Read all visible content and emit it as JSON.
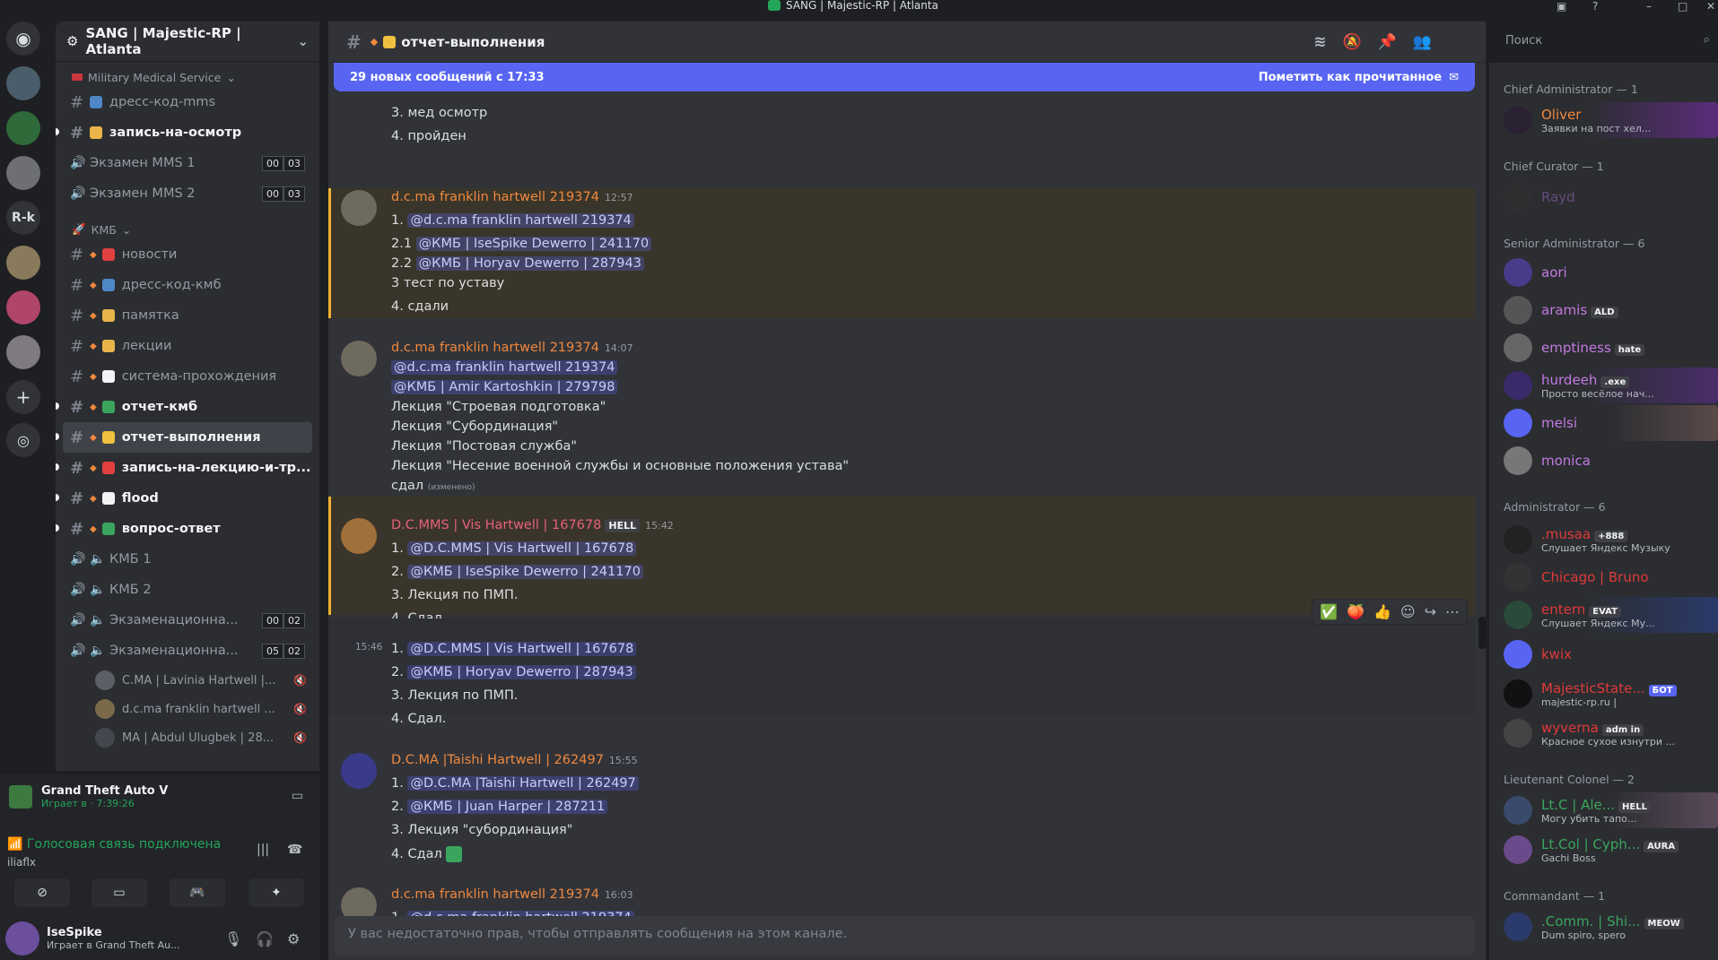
{
  "window": {
    "title": "SANG | Majestic-RP | Atlanta"
  },
  "rail": {
    "rk_label": "R-k"
  },
  "server": {
    "name": "SANG | Majestic-RP | Atlanta"
  },
  "sidebar": {
    "cat1": "Military Medical Service",
    "cat1_channels": [
      {
        "name": "дресс-код-mms",
        "type": "text"
      },
      {
        "name": "запись-на-осмотр",
        "type": "text",
        "unread": true
      },
      {
        "name": "Экзамен MMS 1",
        "type": "voice",
        "c1": "00",
        "c2": "03"
      },
      {
        "name": "Экзамен MMS 2",
        "type": "voice",
        "c1": "00",
        "c2": "03"
      }
    ],
    "cat2": "КМБ",
    "cat2_channels": [
      {
        "name": "новости"
      },
      {
        "name": "дресс-код-кмб"
      },
      {
        "name": "памятка"
      },
      {
        "name": "лекции"
      },
      {
        "name": "система-прохождения"
      },
      {
        "name": "отчет-кмб",
        "unread": true
      },
      {
        "name": "отчет-выполнения",
        "active": true
      },
      {
        "name": "запись-на-лекцию-и-тр...",
        "unread": true
      },
      {
        "name": "flood",
        "unread": true
      },
      {
        "name": "вопрос-ответ",
        "unread": true
      }
    ],
    "voice_channels": [
      {
        "name": "КМБ 1"
      },
      {
        "name": "КМБ 2"
      },
      {
        "name": "Экзаменационна...",
        "c1": "00",
        "c2": "02"
      },
      {
        "name": "Экзаменационна...",
        "c1": "05",
        "c2": "02"
      }
    ],
    "voice_users": [
      "C.MA | Lavinia Hartwell |...",
      "d.c.ma franklin hartwell ...",
      "MA | Abdul Ulugbek | 28..."
    ]
  },
  "panel": {
    "game_title": "Grand Theft Auto V",
    "game_time": "Играет в · 7:39:26",
    "voice_status": "Голосовая связь подключена",
    "voice_user": "iliaflx",
    "user_name": "IseSpike",
    "user_status": "Играет в Grand Theft Au..."
  },
  "chat": {
    "channel": "отчет-выполнения",
    "new_messages": "29 новых сообщений с 17:33",
    "mark_read": "Пометить как прочитанное",
    "search_placeholder": "Поиск",
    "composer": "У вас недостаточно прав, чтобы отправлять сообщения на этом канале.",
    "top_lines": [
      "3. мед осмотр",
      "4. пройден"
    ],
    "messages": [
      {
        "author": "d.c.ma franklin hartwell 219374",
        "time": "12:57",
        "lines": {
          "l1_pre": "1. ",
          "l1_m": "@d.c.ma franklin hartwell 219374",
          "l2_pre": "2.1 ",
          "l2_m": "@КМБ | IseSpike Dewerro | 241170",
          "l3_pre": "2.2 ",
          "l3_m": "@КМБ | Horyav Dewerro | 287943",
          "l4": "3 тест по уставу",
          "l5": "4. сдали"
        }
      },
      {
        "author": "d.c.ma franklin hartwell 219374",
        "time": "14:07",
        "lines": {
          "l1_m": "@d.c.ma franklin hartwell 219374",
          "l2_m": "@КМБ | Amir Kartoshkin | 279798",
          "l3": "Лекция \"Строевая подготовка\"",
          "l4": "Лекция \"Субординация\"",
          "l5": "Лекция \"Постовая служба\"",
          "l6": "Лекция \"Несение военной службы и основные положения устава\"",
          "l7": "сдал",
          "edited": "(изменено)"
        }
      },
      {
        "author": "D.C.MMS | Vis Hartwell | 167678",
        "tag": "HELL",
        "time": "15:42",
        "lines": {
          "l1_pre": "1. ",
          "l1_m": "@D.C.MMS | Vis Hartwell | 167678",
          "l2_pre": "2. ",
          "l2_m": "@КМБ | IseSpike Dewerro | 241170",
          "l3": "3. Лекция по ПМП.",
          "l4": "4. Сдал."
        }
      },
      {
        "time": "15:46",
        "lines": {
          "l1_pre": "1. ",
          "l1_m": "@D.C.MMS | Vis Hartwell | 167678",
          "l2_pre": "2. ",
          "l2_m": "@КМБ | Horyav Dewerro | 287943",
          "l3": "3. Лекция по ПМП.",
          "l4": "4. Сдал."
        }
      },
      {
        "author": "D.C.MA |Taishi Hartwell | 262497",
        "time": "15:55",
        "lines": {
          "l1_pre": "1. ",
          "l1_m": "@D.C.MA |Taishi Hartwell | 262497",
          "l2_pre": "2. ",
          "l2_m": "@КМБ | Juan Harper | 287211",
          "l3": "3. Лекция \"субординация\"",
          "l4": "4. Сдал"
        }
      },
      {
        "author": "d.c.ma franklin hartwell 219374",
        "time": "16:03",
        "lines": {
          "l1_pre": "1. ",
          "l1_m": "@d.c.ma franklin hartwell 219374"
        }
      }
    ]
  },
  "members": {
    "roles": [
      "Chief Administrator — 1",
      "Chief Curator — 1",
      "Senior Administrator — 6",
      "Administrator — 6",
      "Lieutenant Colonel — 2",
      "Commandant — 1"
    ],
    "list": [
      {
        "name": "Oliver",
        "status": "Заявки на пост хел...",
        "color": "#f0883e"
      },
      {
        "name": "Rayd",
        "color": "#a970d6"
      },
      {
        "name": "aori",
        "color": "#c27ae0"
      },
      {
        "name": "aramis",
        "badge": "ALD",
        "color": "#c27ae0"
      },
      {
        "name": "emptiness",
        "badge": "hate",
        "color": "#c27ae0"
      },
      {
        "name": "hurdeeh",
        "badge": ".exe",
        "status": "Просто весёлое нач...",
        "color": "#c27ae0"
      },
      {
        "name": "melsi",
        "color": "#c27ae0"
      },
      {
        "name": "monica",
        "color": "#c27ae0"
      },
      {
        "name": ".musaa",
        "badge": "+888",
        "status": "Слушает Яндекс Музыку",
        "color": "#e03a3a"
      },
      {
        "name": "Chicago | Bruno",
        "color": "#e03a3a"
      },
      {
        "name": "entern",
        "badge": "EVAT",
        "status": "Слушает Яндекс Му...",
        "color": "#e03a3a"
      },
      {
        "name": "kwix",
        "color": "#e03a3a"
      },
      {
        "name": "MajesticState...",
        "bot": "БОТ",
        "status": "majestic-rp.ru |",
        "color": "#e03a3a"
      },
      {
        "name": "wyverna",
        "badge": "adm in",
        "status": "Красное сухое изнутри ...",
        "color": "#e03a3a"
      },
      {
        "name": "Lt.C | Ale...",
        "badge": "HELL",
        "status": "Могу убить тапо...",
        "color": "#3ba55d"
      },
      {
        "name": "Lt.Col | Cyph...",
        "badge": "AURA",
        "status": "Gachi Boss",
        "color": "#3ba55d"
      },
      {
        "name": ".Comm. | Shi...",
        "badge": "MEOW",
        "status": "Dum spiro, spero",
        "color": "#3ba55d"
      }
    ]
  }
}
